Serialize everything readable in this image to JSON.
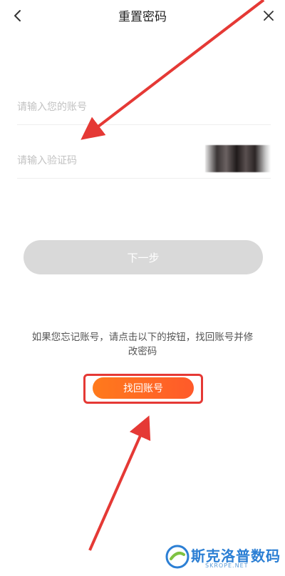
{
  "header": {
    "title": "重置密码",
    "back_icon": "chevron-left-icon",
    "close_icon": "close-icon"
  },
  "form": {
    "account_placeholder": "请输入您的账号",
    "account_value": "",
    "code_placeholder": "请输入验证码",
    "code_value": "",
    "captcha": "captcha-image (blurred)"
  },
  "next_button": {
    "label": "下一步",
    "state": "disabled",
    "color": "#d9d9d9"
  },
  "recover": {
    "hint": "如果您忘记账号，请点击以下的按钮，找回账号并修改密码",
    "button_label": "找回账号",
    "button_color": "#ff6a24",
    "highlight_color": "#e53935"
  },
  "watermark": {
    "name": "斯克洛普数码",
    "url": "SKROPE.NET"
  }
}
